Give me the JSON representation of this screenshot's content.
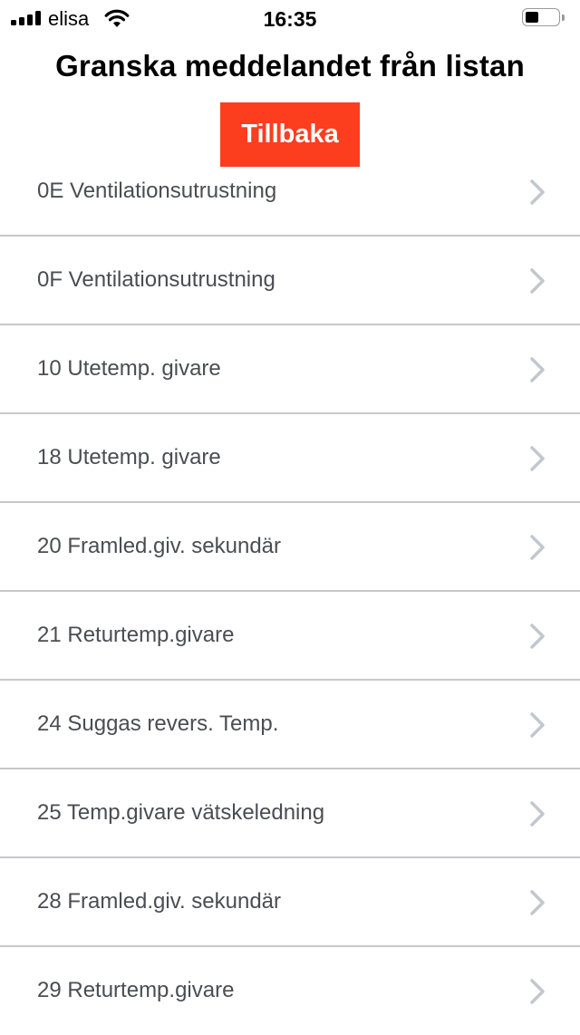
{
  "status_bar": {
    "carrier": "elisa",
    "time": "16:35",
    "signal_bars": 4,
    "battery_level": 0.4
  },
  "page": {
    "title": "Granska meddelandet från listan"
  },
  "back_button": {
    "label": "Tillbaka",
    "color": "#fc3d1e"
  },
  "list": {
    "items": [
      {
        "label": "0E Ventilationsutrustning"
      },
      {
        "label": "0F Ventilationsutrustning"
      },
      {
        "label": "10 Utetemp. givare"
      },
      {
        "label": "18 Utetemp. givare"
      },
      {
        "label": "20 Framled.giv. sekundär"
      },
      {
        "label": "21 Returtemp.givare"
      },
      {
        "label": "24 Suggas revers. Temp."
      },
      {
        "label": "25 Temp.givare vätskeledning"
      },
      {
        "label": "28 Framled.giv. sekundär"
      },
      {
        "label": "29 Returtemp.givare"
      }
    ]
  }
}
